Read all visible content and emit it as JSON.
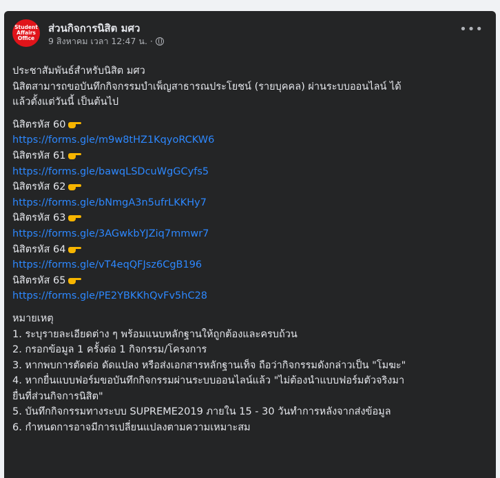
{
  "post": {
    "page_name": "ส่วนกิจการนิสิต มศว",
    "avatar_lines": [
      "Student",
      "Affairs",
      "Office"
    ],
    "timestamp": "9 สิงหาคม เวลา 12:47 น. ·",
    "privacy_icon": "globe-icon",
    "more_label": "•••"
  },
  "body": {
    "intro": [
      "ประชาสัมพันธ์สำหรับนิสิต มศว",
      "นิสิตสามารถขอบันทึกกิจกรรมบำเพ็ญสาธารณประโยชน์ (รายบุคคล) ผ่านระบบออนไลน์ ได้",
      "แล้วตั้งแต่วันนี้ เป็นต้นไป"
    ],
    "groups": [
      {
        "label": "นิสิตรหัส 60",
        "link": "https://forms.gle/m9w8tHZ1KqyoRCKW6"
      },
      {
        "label": "นิสิตรหัส 61",
        "link": "https://forms.gle/bawqLSDcuWgGCyfs5"
      },
      {
        "label": "นิสิตรหัส 62",
        "link": "https://forms.gle/bNmgA3n5ufrLKKHy7"
      },
      {
        "label": "นิสิตรหัส 63",
        "link": "https://forms.gle/3AGwkbYJZiq7mmwr7"
      },
      {
        "label": "นิสิตรหัส 64",
        "link": "https://forms.gle/vT4eqQFJsz6CgB196"
      },
      {
        "label": "นิสิตรหัส 65",
        "link": "https://forms.gle/PE2YBKKhQvFv5hC28"
      }
    ],
    "notes_title": "หมายเหตุ",
    "notes": [
      "1. ระบุรายละเอียดต่าง ๆ พร้อมแนบหลักฐานให้ถูกต้องและครบถ้วน",
      "2. กรอกข้อมูล 1 ครั้งต่อ 1 กิจกรรม/โครงการ",
      "3. หากพบการตัดต่อ ดัดแปลง หรือส่งเอกสารหลักฐานเท็จ ถือว่ากิจกรรมดังกล่าวเป็น \"โมฆะ\"",
      "4. หากยื่นแบบฟอร์มขอบันทึกกิจกรรมผ่านระบบออนไลน์แล้ว \"ไม่ต้องนำแบบฟอร์มตัวจริงมา",
      "ยื่นที่ส่วนกิจการนิสิต\"",
      "5. บันทึกกิจกรรมทางระบบ SUPREME2019 ภายใน 15 - 30 วันทำการหลังจากส่งข้อมูล",
      "6. กำหนดการอาจมีการเปลี่ยนแปลงตามความเหมาะสม"
    ]
  }
}
